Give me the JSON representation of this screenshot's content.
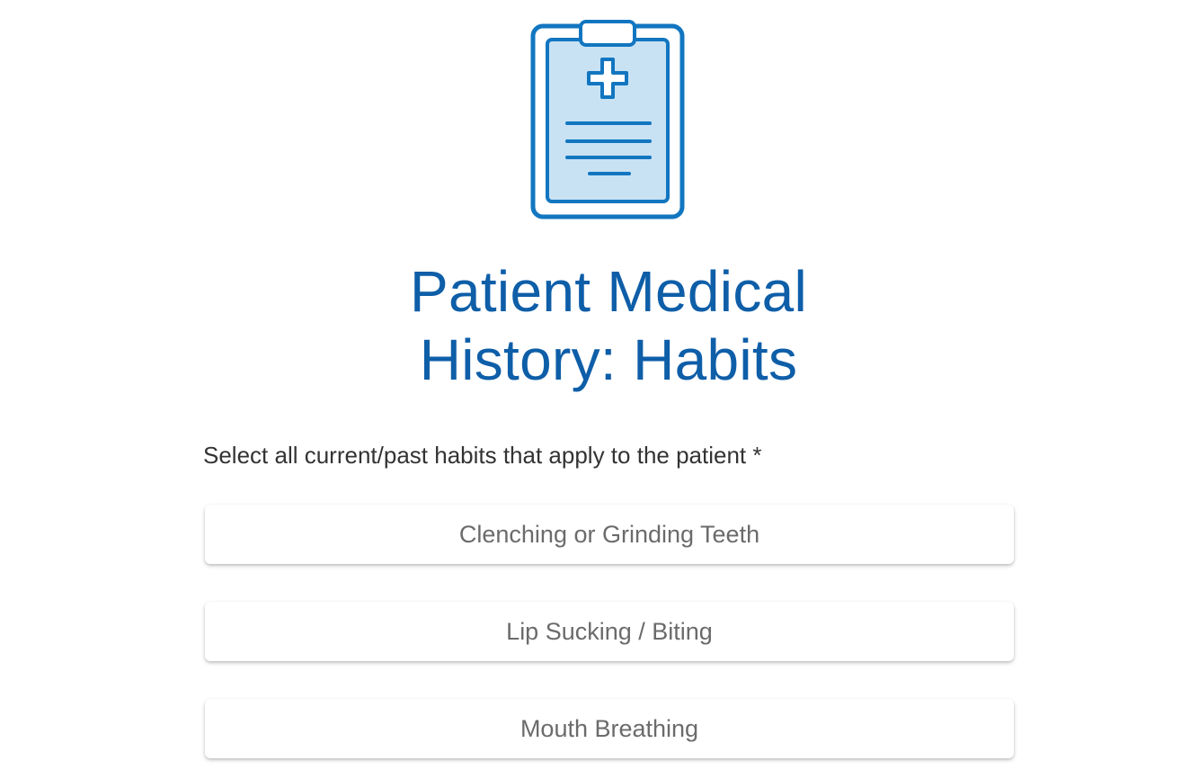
{
  "header": {
    "icon": "clipboard-medical-icon",
    "title_line1": "Patient Medical",
    "title_line2": "History: Habits"
  },
  "question": {
    "prompt": "Select all current/past habits that apply to the patient *"
  },
  "options": [
    {
      "label": "Clenching or Grinding Teeth"
    },
    {
      "label": "Lip Sucking / Biting"
    },
    {
      "label": "Mouth Breathing"
    }
  ],
  "colors": {
    "brand_blue": "#0e5ea8",
    "icon_blue": "#1276c0",
    "icon_fill": "#c8e2f4",
    "prompt_text": "#333333",
    "option_text": "#6b6b6b"
  }
}
